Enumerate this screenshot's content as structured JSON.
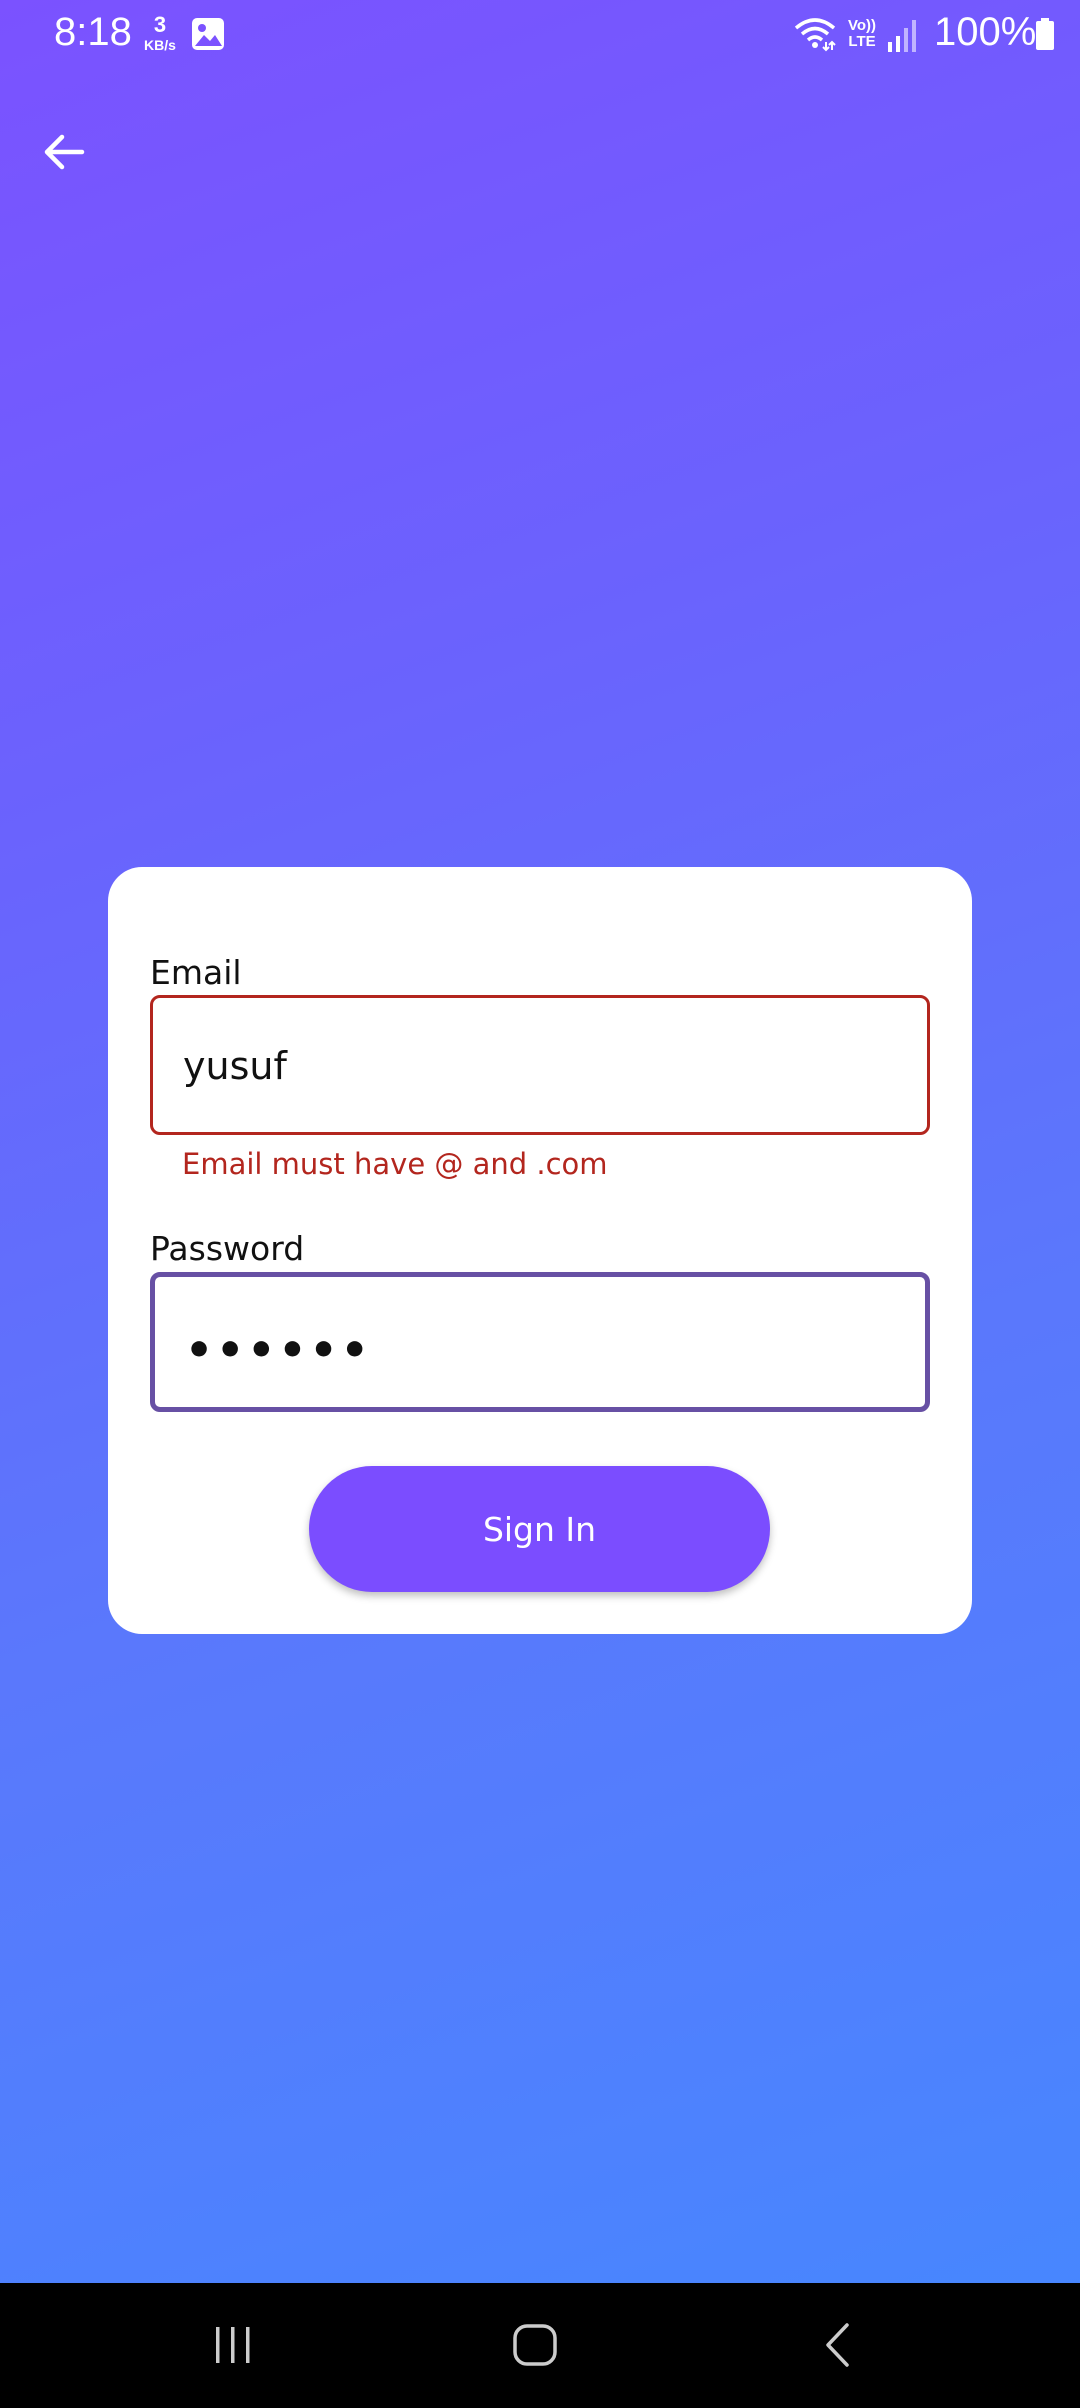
{
  "status_bar": {
    "time": "8:18",
    "net_speed_value": "3",
    "net_speed_unit": "KB/s",
    "lte_top": "Vo))",
    "lte_bottom": "LTE",
    "battery": "100%"
  },
  "form": {
    "email_label": "Email",
    "email_value": "yusuf",
    "email_error": "Email must have @ and .com",
    "password_label": "Password",
    "password_value": "••••••",
    "submit_label": "Sign In"
  },
  "colors": {
    "accent": "#7b4dff",
    "error": "#b3261e",
    "focus": "#6750a4"
  }
}
